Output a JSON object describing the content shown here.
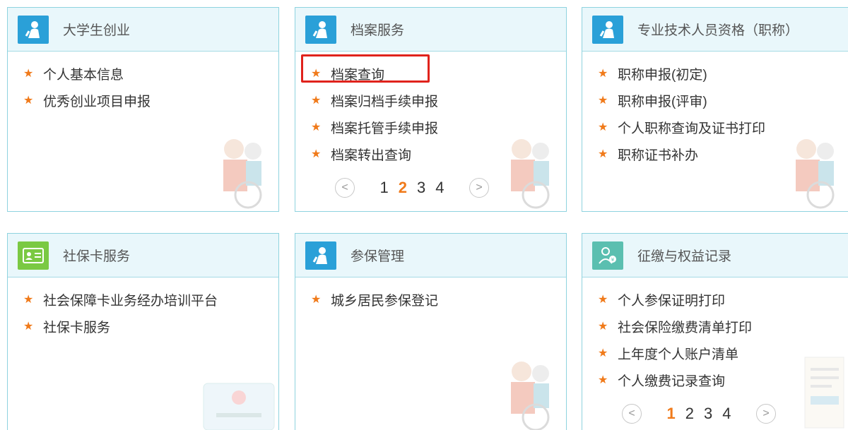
{
  "cards": [
    {
      "title": "大学生创业",
      "icon": "person-icon",
      "items": [
        "个人基本信息",
        "优秀创业项目申报"
      ]
    },
    {
      "title": "档案服务",
      "icon": "person-icon",
      "items": [
        "档案查询",
        "档案归档手续申报",
        "档案托管手续申报",
        "档案转出查询"
      ],
      "pagination": {
        "prev": "<",
        "next": ">",
        "pages": [
          "1",
          "2",
          "3",
          "4"
        ],
        "current": "2"
      }
    },
    {
      "title": "专业技术人员资格（职称）",
      "icon": "person-icon",
      "items": [
        "职称申报(初定)",
        "职称申报(评审)",
        "个人职称查询及证书打印",
        "职称证书补办"
      ]
    },
    {
      "title": "社保卡服务",
      "icon": "id-card-icon",
      "icon_color": "#7ac943",
      "items": [
        "社会保障卡业务经办培训平台",
        "社保卡服务"
      ]
    },
    {
      "title": "参保管理",
      "icon": "person-icon",
      "items": [
        "城乡居民参保登记"
      ]
    },
    {
      "title": "征缴与权益记录",
      "icon": "person-search-icon",
      "icon_color": "#5bbfb0",
      "items": [
        "个人参保证明打印",
        "社会保险缴费清单打印",
        "上年度个人账户清单",
        "个人缴费记录查询"
      ],
      "pagination": {
        "prev": "<",
        "next": ">",
        "pages": [
          "1",
          "2",
          "3",
          "4"
        ],
        "current": "1"
      }
    }
  ],
  "colors": {
    "icon_blue": "#2aa0d8",
    "star": "#f07a1a",
    "highlight": "#e0231c"
  }
}
